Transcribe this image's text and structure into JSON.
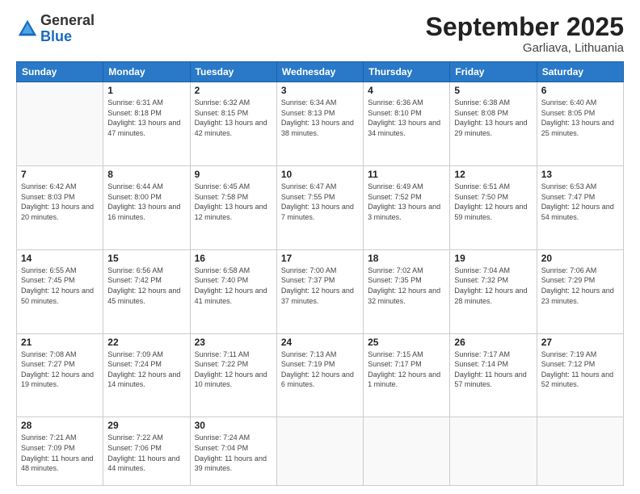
{
  "logo": {
    "general": "General",
    "blue": "Blue"
  },
  "title": "September 2025",
  "location": "Garliava, Lithuania",
  "weekdays": [
    "Sunday",
    "Monday",
    "Tuesday",
    "Wednesday",
    "Thursday",
    "Friday",
    "Saturday"
  ],
  "days": [
    {
      "date": "",
      "sunrise": "",
      "sunset": "",
      "daylight": ""
    },
    {
      "date": "1",
      "sunrise": "6:31 AM",
      "sunset": "8:18 PM",
      "daylight": "13 hours and 47 minutes."
    },
    {
      "date": "2",
      "sunrise": "6:32 AM",
      "sunset": "8:15 PM",
      "daylight": "13 hours and 42 minutes."
    },
    {
      "date": "3",
      "sunrise": "6:34 AM",
      "sunset": "8:13 PM",
      "daylight": "13 hours and 38 minutes."
    },
    {
      "date": "4",
      "sunrise": "6:36 AM",
      "sunset": "8:10 PM",
      "daylight": "13 hours and 34 minutes."
    },
    {
      "date": "5",
      "sunrise": "6:38 AM",
      "sunset": "8:08 PM",
      "daylight": "13 hours and 29 minutes."
    },
    {
      "date": "6",
      "sunrise": "6:40 AM",
      "sunset": "8:05 PM",
      "daylight": "13 hours and 25 minutes."
    },
    {
      "date": "7",
      "sunrise": "6:42 AM",
      "sunset": "8:03 PM",
      "daylight": "13 hours and 20 minutes."
    },
    {
      "date": "8",
      "sunrise": "6:44 AM",
      "sunset": "8:00 PM",
      "daylight": "13 hours and 16 minutes."
    },
    {
      "date": "9",
      "sunrise": "6:45 AM",
      "sunset": "7:58 PM",
      "daylight": "13 hours and 12 minutes."
    },
    {
      "date": "10",
      "sunrise": "6:47 AM",
      "sunset": "7:55 PM",
      "daylight": "13 hours and 7 minutes."
    },
    {
      "date": "11",
      "sunrise": "6:49 AM",
      "sunset": "7:52 PM",
      "daylight": "13 hours and 3 minutes."
    },
    {
      "date": "12",
      "sunrise": "6:51 AM",
      "sunset": "7:50 PM",
      "daylight": "12 hours and 59 minutes."
    },
    {
      "date": "13",
      "sunrise": "6:53 AM",
      "sunset": "7:47 PM",
      "daylight": "12 hours and 54 minutes."
    },
    {
      "date": "14",
      "sunrise": "6:55 AM",
      "sunset": "7:45 PM",
      "daylight": "12 hours and 50 minutes."
    },
    {
      "date": "15",
      "sunrise": "6:56 AM",
      "sunset": "7:42 PM",
      "daylight": "12 hours and 45 minutes."
    },
    {
      "date": "16",
      "sunrise": "6:58 AM",
      "sunset": "7:40 PM",
      "daylight": "12 hours and 41 minutes."
    },
    {
      "date": "17",
      "sunrise": "7:00 AM",
      "sunset": "7:37 PM",
      "daylight": "12 hours and 37 minutes."
    },
    {
      "date": "18",
      "sunrise": "7:02 AM",
      "sunset": "7:35 PM",
      "daylight": "12 hours and 32 minutes."
    },
    {
      "date": "19",
      "sunrise": "7:04 AM",
      "sunset": "7:32 PM",
      "daylight": "12 hours and 28 minutes."
    },
    {
      "date": "20",
      "sunrise": "7:06 AM",
      "sunset": "7:29 PM",
      "daylight": "12 hours and 23 minutes."
    },
    {
      "date": "21",
      "sunrise": "7:08 AM",
      "sunset": "7:27 PM",
      "daylight": "12 hours and 19 minutes."
    },
    {
      "date": "22",
      "sunrise": "7:09 AM",
      "sunset": "7:24 PM",
      "daylight": "12 hours and 14 minutes."
    },
    {
      "date": "23",
      "sunrise": "7:11 AM",
      "sunset": "7:22 PM",
      "daylight": "12 hours and 10 minutes."
    },
    {
      "date": "24",
      "sunrise": "7:13 AM",
      "sunset": "7:19 PM",
      "daylight": "12 hours and 6 minutes."
    },
    {
      "date": "25",
      "sunrise": "7:15 AM",
      "sunset": "7:17 PM",
      "daylight": "12 hours and 1 minute."
    },
    {
      "date": "26",
      "sunrise": "7:17 AM",
      "sunset": "7:14 PM",
      "daylight": "11 hours and 57 minutes."
    },
    {
      "date": "27",
      "sunrise": "7:19 AM",
      "sunset": "7:12 PM",
      "daylight": "11 hours and 52 minutes."
    },
    {
      "date": "28",
      "sunrise": "7:21 AM",
      "sunset": "7:09 PM",
      "daylight": "11 hours and 48 minutes."
    },
    {
      "date": "29",
      "sunrise": "7:22 AM",
      "sunset": "7:06 PM",
      "daylight": "11 hours and 44 minutes."
    },
    {
      "date": "30",
      "sunrise": "7:24 AM",
      "sunset": "7:04 PM",
      "daylight": "11 hours and 39 minutes."
    }
  ]
}
